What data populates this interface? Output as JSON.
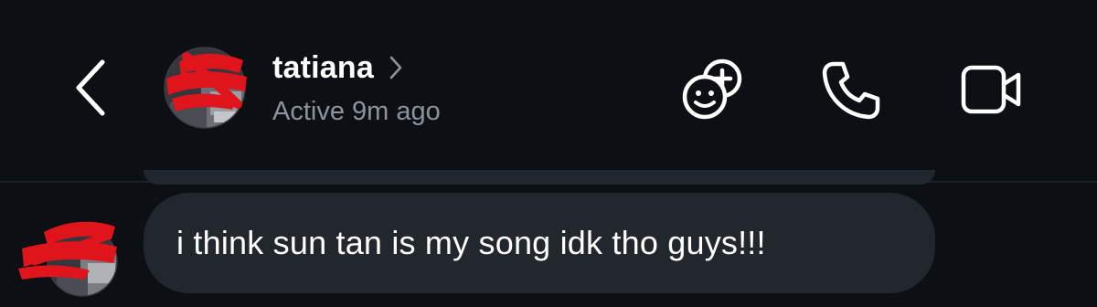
{
  "header": {
    "contact_name": "tatiana",
    "status": "Active 9m ago",
    "icons": {
      "back": "chevron-left-icon",
      "profile": "chevron-right-icon",
      "effects": "effects-icon",
      "call": "phone-icon",
      "video": "video-camera-icon"
    }
  },
  "messages": [
    {
      "sender": "tatiana",
      "text": "i think sun tan is my song idk tho guys!!!"
    }
  ],
  "colors": {
    "background": "#0c0f14",
    "bubble": "#22262d",
    "secondary_text": "#8e939b",
    "redaction": "#e0151b"
  }
}
